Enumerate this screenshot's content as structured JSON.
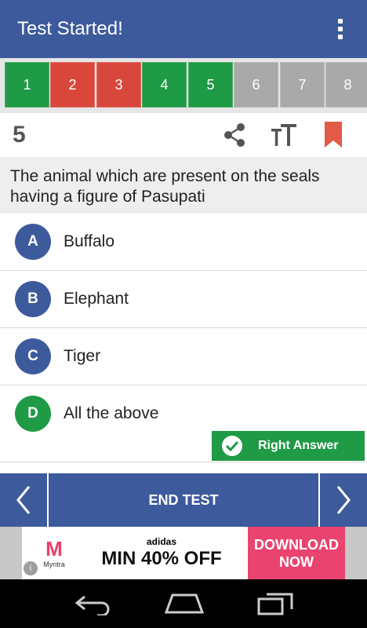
{
  "appbar": {
    "title": "Test Started!",
    "menu_icon": "more-vert-icon"
  },
  "strip": {
    "items": [
      {
        "label": "1",
        "status": "correct"
      },
      {
        "label": "2",
        "status": "wrong"
      },
      {
        "label": "3",
        "status": "wrong"
      },
      {
        "label": "4",
        "status": "correct"
      },
      {
        "label": "5",
        "status": "correct"
      },
      {
        "label": "6",
        "status": "unanswered"
      },
      {
        "label": "7",
        "status": "unanswered"
      },
      {
        "label": "8",
        "status": "unanswered"
      }
    ]
  },
  "toolbar": {
    "question_number": "5",
    "share_icon": "share-icon",
    "text_size_icon": "text-size-icon",
    "bookmark_icon": "bookmark-icon"
  },
  "question": {
    "text": "The animal which are present on the seals having a figure of Pasupati"
  },
  "options": [
    {
      "letter": "A",
      "text": "Buffalo"
    },
    {
      "letter": "B",
      "text": "Elephant"
    },
    {
      "letter": "C",
      "text": "Tiger"
    },
    {
      "letter": "D",
      "text": "All the above"
    }
  ],
  "right_answer": {
    "label": "Right Answer"
  },
  "nav": {
    "end_label": "END TEST"
  },
  "ad": {
    "brand": "Myntra",
    "brand_mark": "M",
    "sponsor": "adidas",
    "offer": "MIN 40% OFF",
    "cta_line1": "DOWNLOAD",
    "cta_line2": "NOW",
    "info": "i"
  },
  "colors": {
    "primary": "#3d5a9c",
    "correct": "#1f9a45",
    "wrong": "#d9473b",
    "unanswered": "#a9a9a9",
    "bookmark": "#e25b48"
  }
}
